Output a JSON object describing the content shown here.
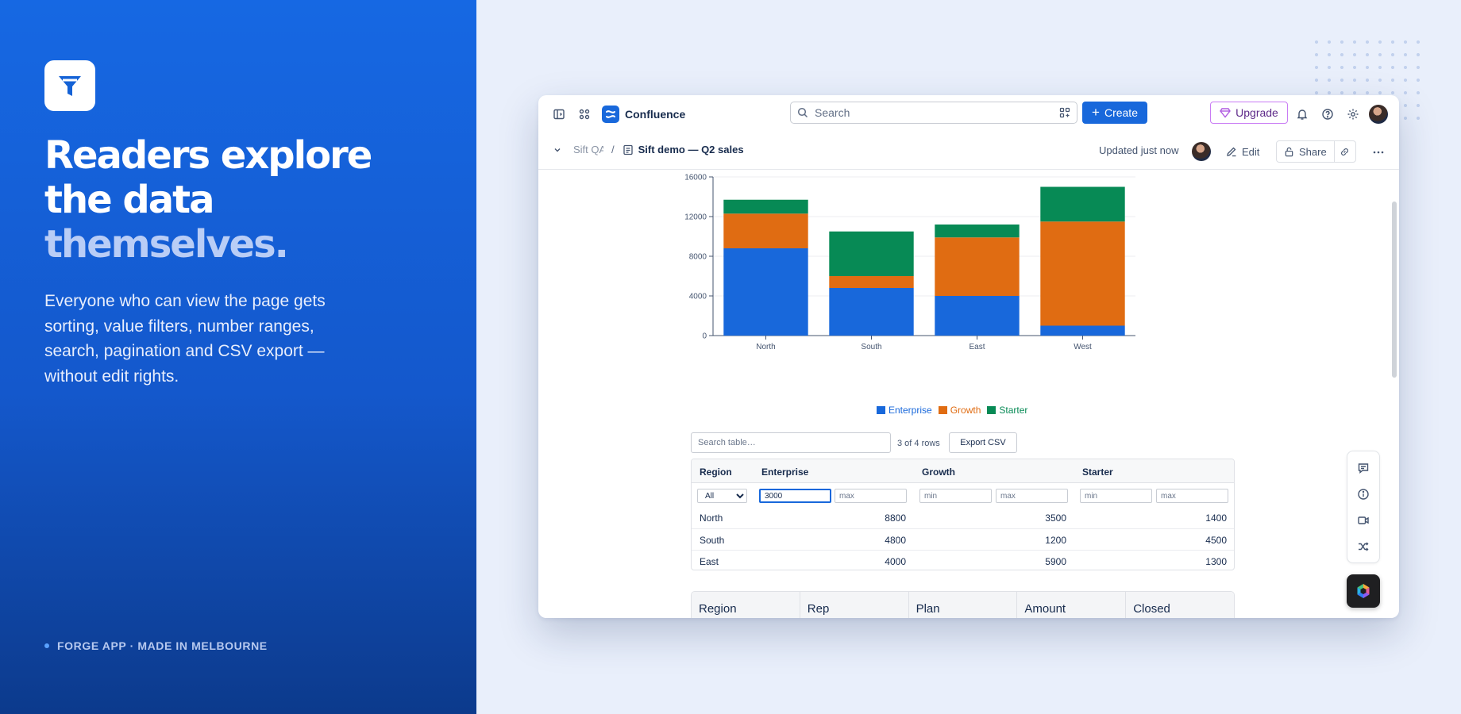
{
  "hero": {
    "title_line1": "Readers explore",
    "title_line2": "the data",
    "title_line3": "themselves.",
    "description": "Everyone who can view the page gets sorting, value filters, number ranges, search, pagination and CSV export — without edit rights.",
    "footer": "FORGE APP · MADE IN MELBOURNE"
  },
  "topbar": {
    "brand": "Confluence",
    "search_placeholder": "Search",
    "create_label": "Create",
    "upgrade_label": "Upgrade"
  },
  "pagebar": {
    "breadcrumb_space": "Sift QA",
    "separator": "/",
    "page_title": "Sift demo — Q2 sales",
    "updated": "Updated just now",
    "edit_label": "Edit",
    "share_label": "Share"
  },
  "colors": {
    "enterprise": "#1868db",
    "growth": "#e06c12",
    "starter": "#078a55",
    "accent": "#1868db"
  },
  "chart_data": {
    "type": "bar",
    "stacked": true,
    "categories": [
      "North",
      "South",
      "East",
      "West"
    ],
    "series": [
      {
        "name": "Enterprise",
        "values": [
          8800,
          4800,
          4000,
          1000
        ]
      },
      {
        "name": "Growth",
        "values": [
          3500,
          1200,
          5900,
          10500
        ]
      },
      {
        "name": "Starter",
        "values": [
          1400,
          4500,
          1300,
          3500
        ]
      }
    ],
    "ylim": [
      0,
      16000
    ],
    "yticks": [
      0,
      4000,
      8000,
      12000,
      16000
    ],
    "grid": true,
    "legend": "bottom"
  },
  "table": {
    "search_placeholder": "Search table…",
    "rows_count": "3 of 4 rows",
    "export_label": "Export CSV",
    "headers": [
      "Region",
      "Enterprise",
      "Growth",
      "Starter"
    ],
    "filters": {
      "region_selected": "All",
      "enterprise_min": "3000",
      "min_placeholder": "min",
      "max_placeholder": "max"
    },
    "rows": [
      {
        "region": "North",
        "enterprise": "8800",
        "growth": "3500",
        "starter": "1400"
      },
      {
        "region": "South",
        "enterprise": "4800",
        "growth": "1200",
        "starter": "4500"
      },
      {
        "region": "East",
        "enterprise": "4000",
        "growth": "5900",
        "starter": "1300"
      }
    ]
  },
  "second_table": {
    "headers": [
      "Region",
      "Rep",
      "Plan",
      "Amount",
      "Closed"
    ]
  }
}
